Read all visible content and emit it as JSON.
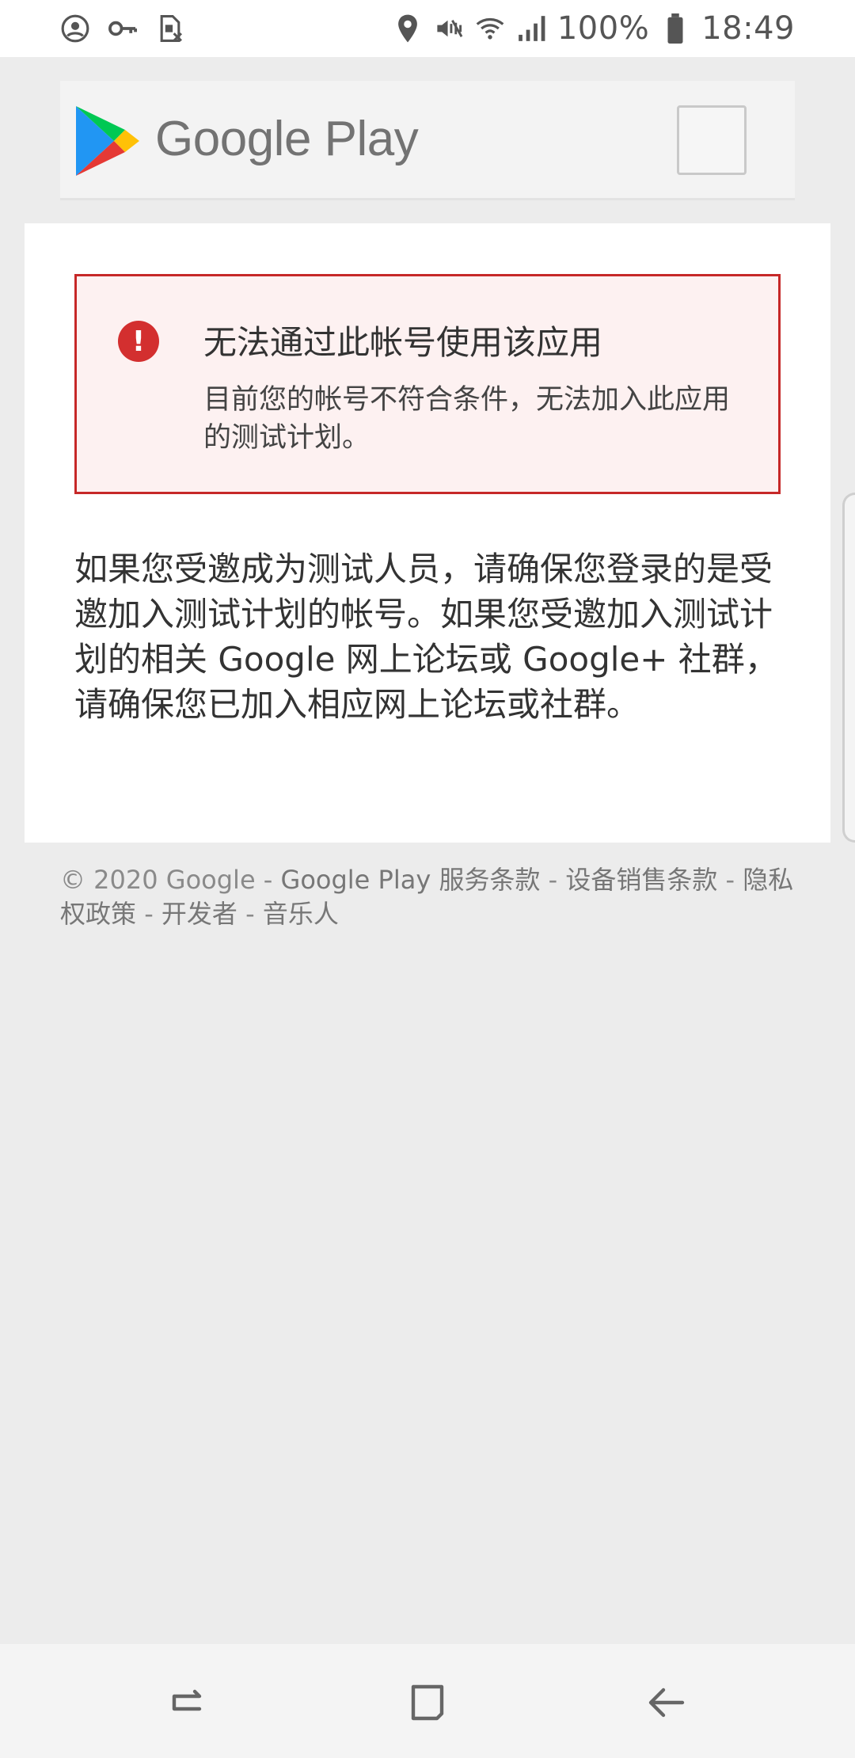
{
  "status_bar": {
    "battery": "100%",
    "time": "18:49",
    "icons": [
      "account-circle-icon",
      "key-icon",
      "sim-off-icon",
      "location-icon",
      "mute-vibrate-icon",
      "wifi-icon",
      "signal-icon",
      "battery-icon"
    ]
  },
  "header": {
    "title": "Google Play",
    "logo": "google-play-logo",
    "menu": "menu-button"
  },
  "error": {
    "title": "无法通过此帐号使用该应用",
    "description": "目前您的帐号不符合条件，无法加入此应用的测试计划。",
    "color": "#d32f2f"
  },
  "info_text": "如果您受邀成为测试人员，请确保您登录的是受邀加入测试计划的帐号。如果您受邀加入测试计划的相关 Google 网上论坛或 Google+ 社群，请确保您已加入相应网上论坛或社群。",
  "footer": {
    "copyright": "© 2020 Google",
    "links": [
      "Google Play 服务条款",
      "设备销售条款",
      "隐私权政策",
      "开发者",
      "音乐人"
    ],
    "separator": " - "
  },
  "nav_bar": {
    "buttons": [
      "recent-apps-icon",
      "home-icon",
      "back-icon"
    ]
  }
}
